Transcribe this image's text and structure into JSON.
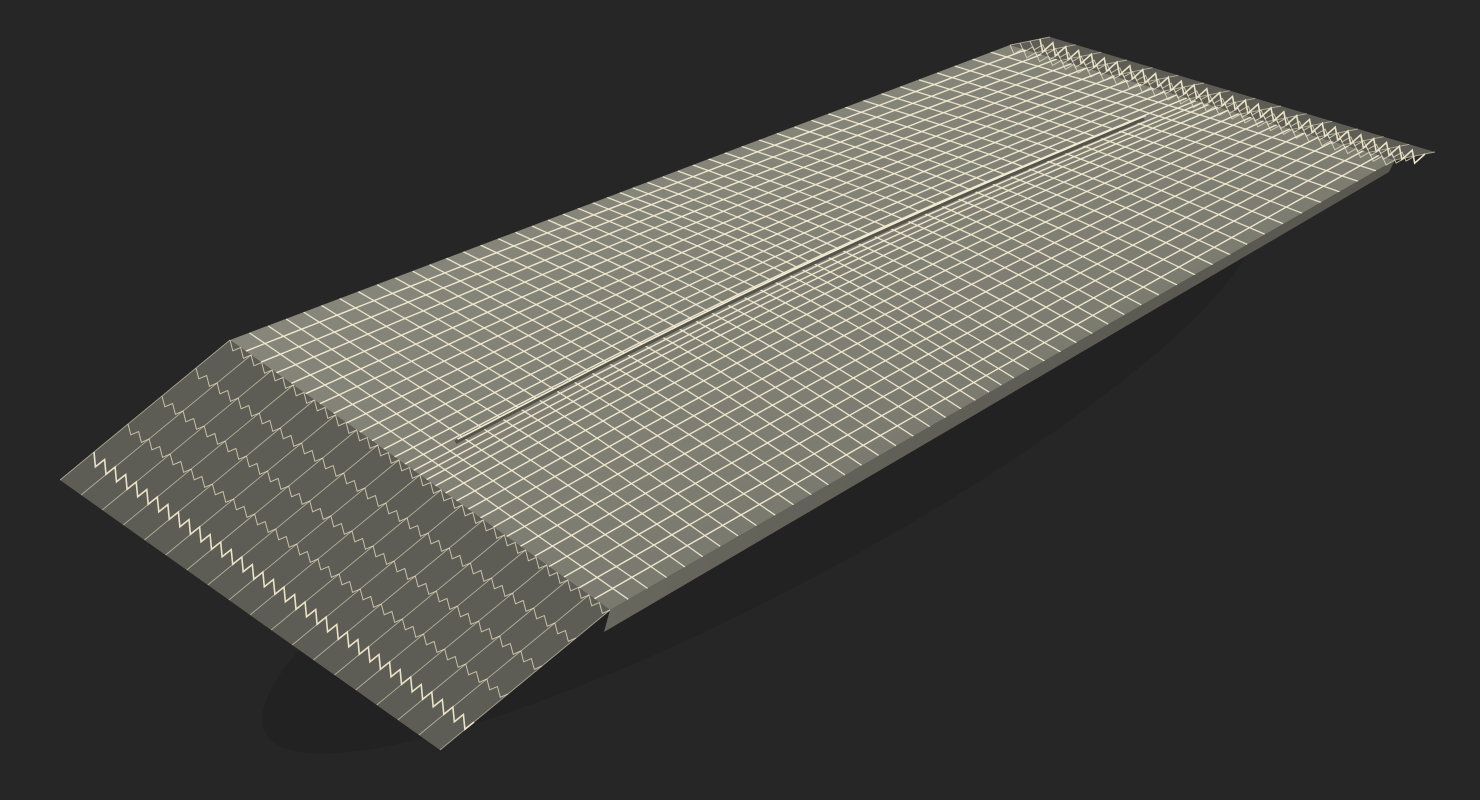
{
  "scene": {
    "subject": "wrapper-mesh",
    "style": "wireframe-over-shaded",
    "colors": {
      "background": "#262626",
      "surface_light": "#8b8a7e",
      "surface_mid": "#7b7a6f",
      "surface_dark": "#5e5d55",
      "wire": "#f2ecd2",
      "seam": "#54534c",
      "crimp": "#e9e2c6"
    }
  }
}
